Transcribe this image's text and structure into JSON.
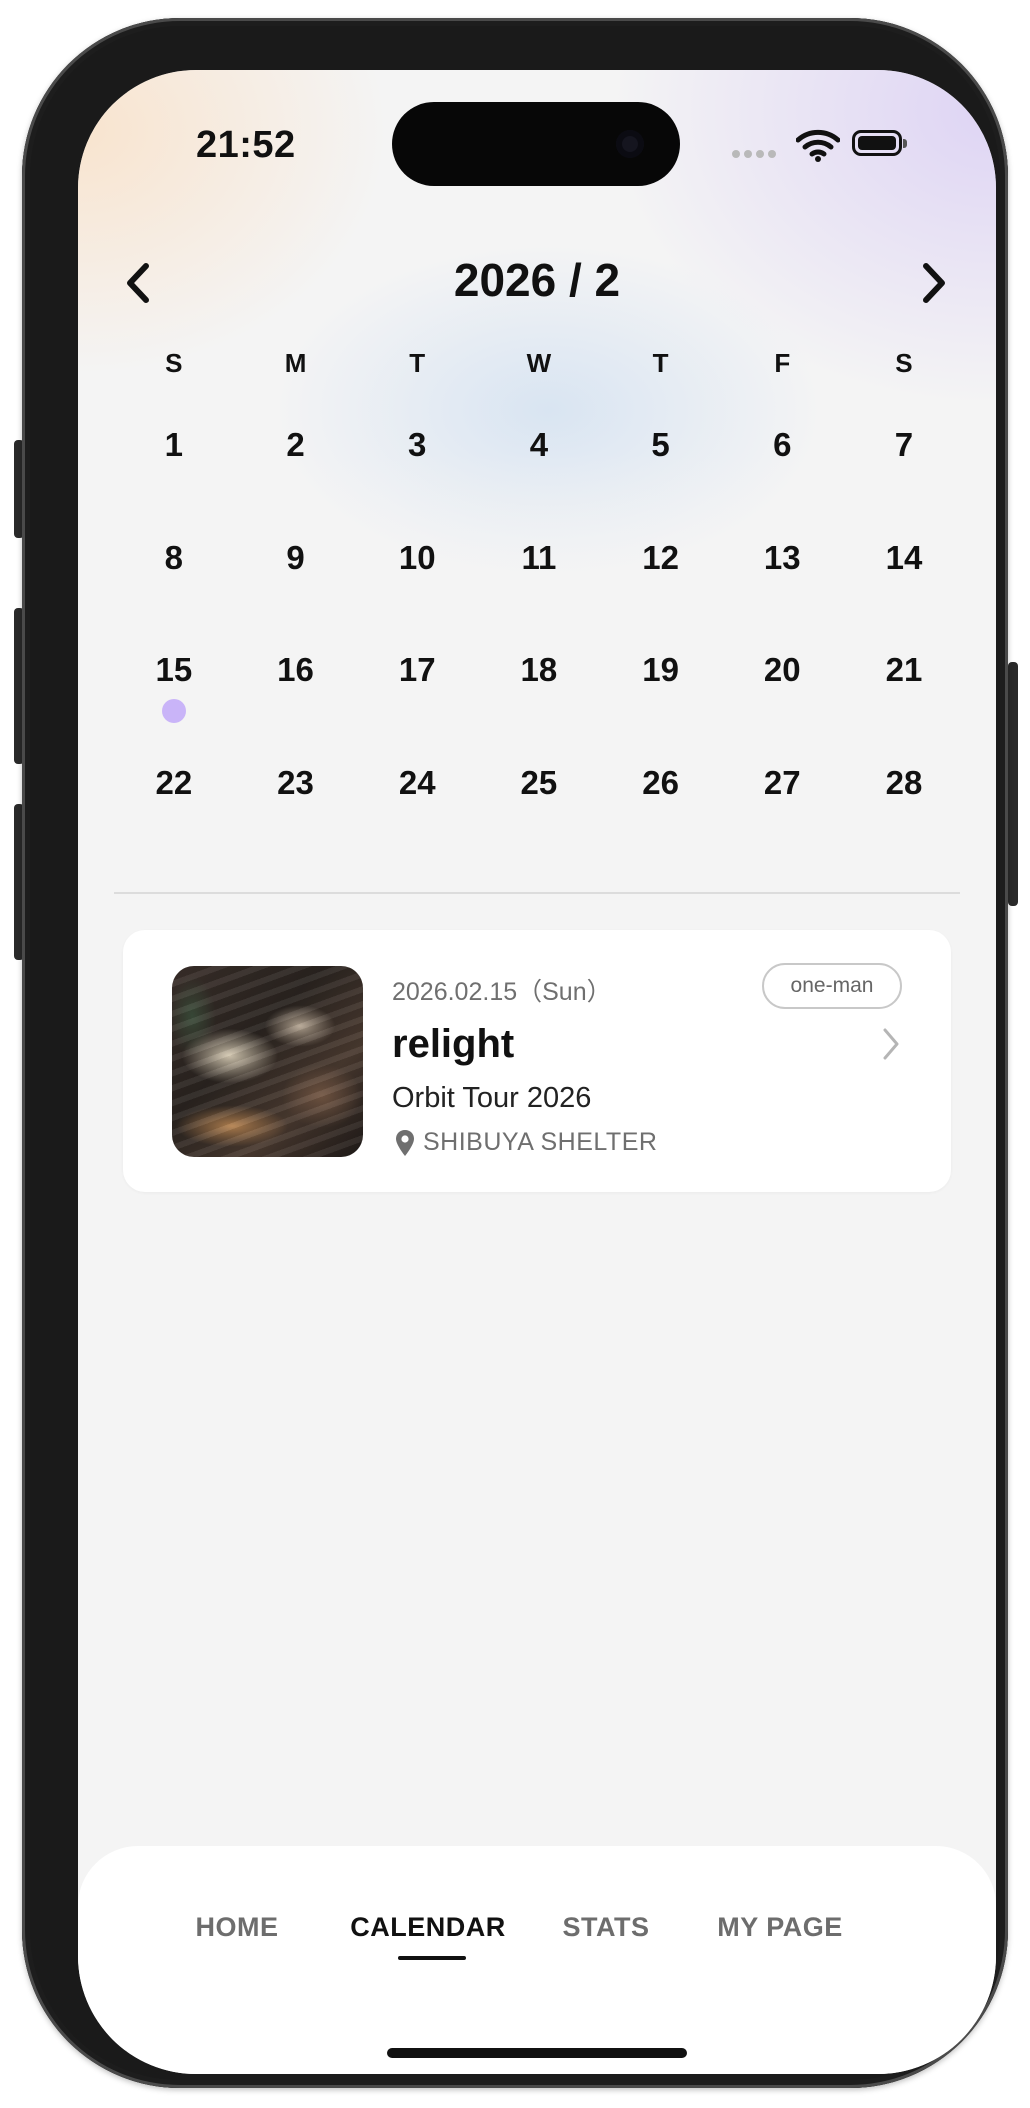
{
  "status_bar": {
    "time": "21:52"
  },
  "calendar": {
    "title": "2026 / 2",
    "weekdays": [
      "S",
      "M",
      "T",
      "W",
      "T",
      "F",
      "S"
    ],
    "weeks": [
      [
        "1",
        "2",
        "3",
        "4",
        "5",
        "6",
        "7"
      ],
      [
        "8",
        "9",
        "10",
        "11",
        "12",
        "13",
        "14"
      ],
      [
        "15",
        "16",
        "17",
        "18",
        "19",
        "20",
        "21"
      ],
      [
        "22",
        "23",
        "24",
        "25",
        "26",
        "27",
        "28"
      ]
    ],
    "event_days": [
      "15"
    ],
    "event_dot_color": "#c9b4f8"
  },
  "event_card": {
    "date": "2026.02.15（Sun）",
    "tag": "one-man",
    "artist": "relight",
    "tour": "Orbit Tour 2026",
    "venue": "SHIBUYA SHELTER"
  },
  "tabbar": {
    "items": [
      {
        "label": "HOME",
        "active": false
      },
      {
        "label": "CALENDAR",
        "active": true
      },
      {
        "label": "STATS",
        "active": false
      },
      {
        "label": "MY PAGE",
        "active": false
      }
    ]
  },
  "icons": {
    "prev": "chevron-left-icon",
    "next": "chevron-right-icon",
    "venue": "location-pin-icon",
    "card_arrow": "chevron-right-icon"
  }
}
